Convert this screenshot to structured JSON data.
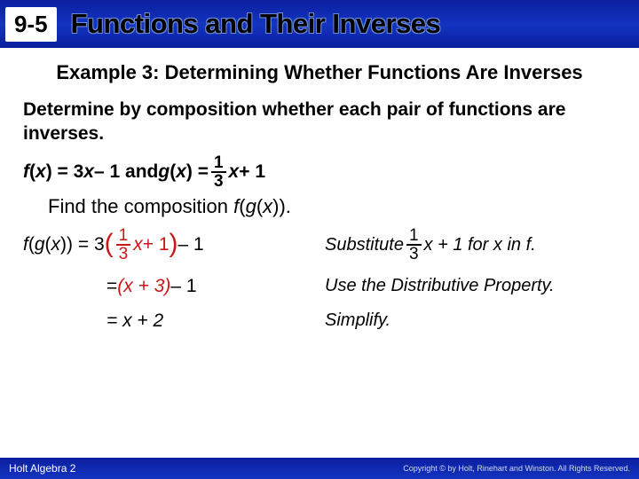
{
  "header": {
    "section": "9-5",
    "title": "Functions and Their Inverses"
  },
  "example_title": "Example 3: Determining Whether Functions Are Inverses",
  "prompt": "Determine by composition whether each pair of functions are inverses.",
  "given": {
    "f_lhs": "f",
    "x": "x",
    "eq1": ") = 3",
    "minus1": " – 1 and ",
    "g_lhs": "g",
    "eq2": ") = ",
    "frac_num": "1",
    "frac_den": "3",
    "plus1": " + 1"
  },
  "find_line": {
    "pre": "Find the composition ",
    "f": "f",
    "g": "g",
    "x": "x",
    "post": "))."
  },
  "steps": [
    {
      "lhs": {
        "f": "f",
        "g": "g",
        "x": "x",
        "open": "(",
        "close": ")) = 3",
        "paren_open": "(",
        "frac_num": "1",
        "frac_den": "3",
        "mid": " + 1",
        "paren_close": ")",
        "tail": " – 1"
      },
      "rhs": {
        "pre": "Substitute ",
        "frac_num": "1",
        "frac_den": "3",
        "mid": " x + 1 for x in f."
      }
    },
    {
      "lhs": {
        "text_pre": "= ",
        "red": "(x + 3)",
        "text_post": " – 1"
      },
      "rhs": {
        "text": "Use the Distributive Property."
      }
    },
    {
      "lhs": {
        "text": "= x + 2"
      },
      "rhs": {
        "text": "Simplify."
      }
    }
  ],
  "footer": {
    "left": "Holt Algebra 2",
    "right": "Copyright © by Holt, Rinehart and Winston. All Rights Reserved."
  }
}
